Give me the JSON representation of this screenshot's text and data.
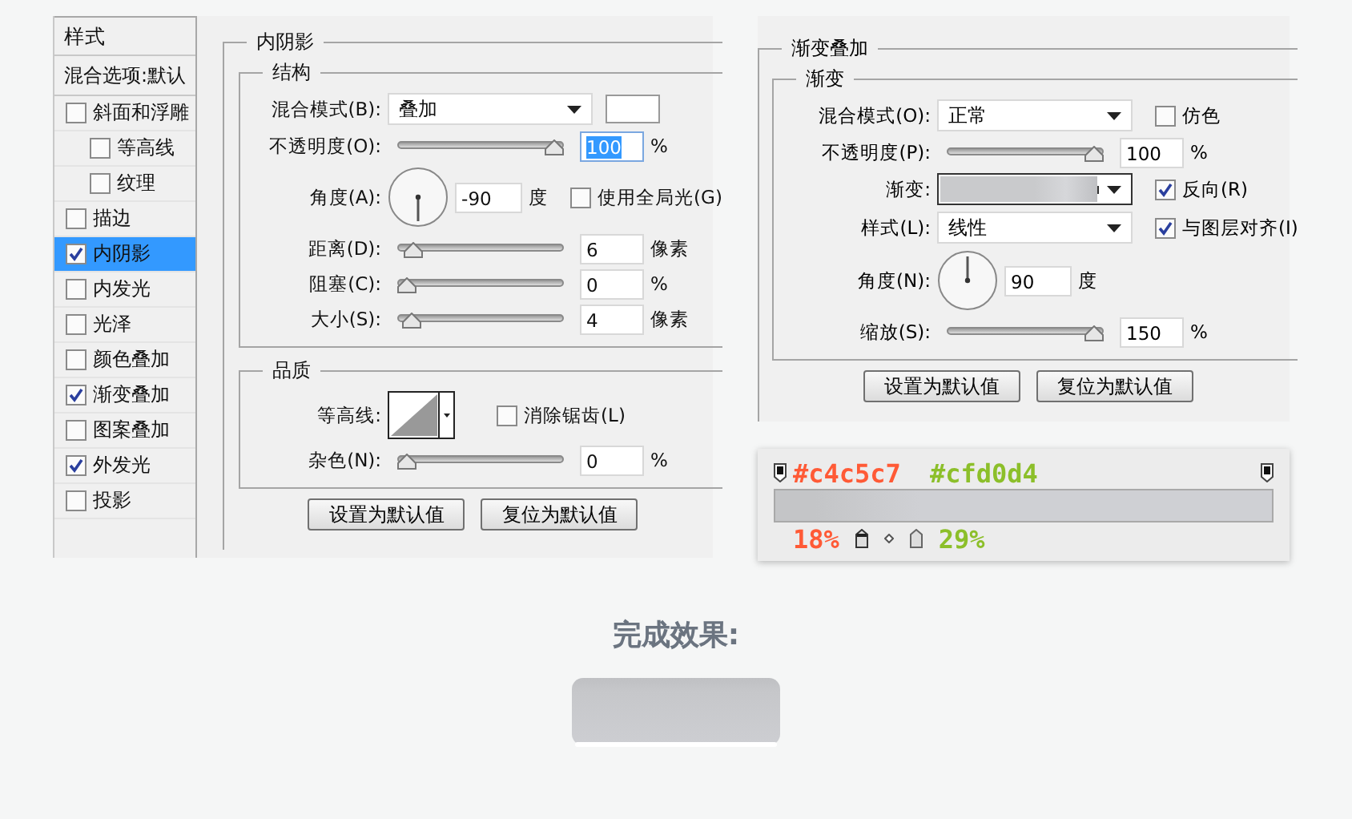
{
  "layer_style": {
    "styles_header": "样式",
    "blend_options": "混合选项:默认",
    "style_items": [
      {
        "label": "斜面和浮雕",
        "checked": false,
        "selected": false,
        "children": [
          {
            "label": "等高线",
            "checked": false,
            "selected": false
          },
          {
            "label": "纹理",
            "checked": false,
            "selected": false
          }
        ]
      },
      {
        "label": "描边",
        "checked": false,
        "selected": false
      },
      {
        "label": "内阴影",
        "checked": true,
        "selected": true
      },
      {
        "label": "内发光",
        "checked": false,
        "selected": false
      },
      {
        "label": "光泽",
        "checked": false,
        "selected": false
      },
      {
        "label": "颜色叠加",
        "checked": false,
        "selected": false
      },
      {
        "label": "渐变叠加",
        "checked": true,
        "selected": false
      },
      {
        "label": "图案叠加",
        "checked": false,
        "selected": false
      },
      {
        "label": "外发光",
        "checked": true,
        "selected": false
      },
      {
        "label": "投影",
        "checked": false,
        "selected": false
      }
    ],
    "panel_title": "内阴影",
    "structure_title": "结构",
    "structure_rows": [
      {
        "kind": "dropdown",
        "label": "混合模式(B):",
        "value": "叠加",
        "swatch": true
      },
      {
        "kind": "slider",
        "label": "不透明度(O):",
        "level": 1,
        "value": "100",
        "unit": "%",
        "focused": true
      },
      {
        "kind": "angle",
        "label": "角度(A):",
        "value": "-90",
        "unit": "度",
        "checkbox": {
          "label": "使用全局光(G)",
          "checked": false
        }
      },
      {
        "kind": "slider",
        "label": "距离(D):",
        "level": 0.04,
        "value": "6",
        "unit": "像素"
      },
      {
        "kind": "slider",
        "label": "阻塞(C):",
        "level": 0,
        "value": "0",
        "unit": "%"
      },
      {
        "kind": "slider",
        "label": "大小(S):",
        "level": 0.03,
        "value": "4",
        "unit": "像素"
      }
    ],
    "quality_title": "品质",
    "quality_rows": [
      {
        "kind": "contour",
        "label": "等高线:",
        "checkbox": {
          "label": "消除锯齿(L)",
          "checked": false
        }
      },
      {
        "kind": "slider",
        "label": "杂色(N):",
        "level": 0,
        "value": "0",
        "unit": "%"
      }
    ],
    "buttons": [
      "设置为默认值",
      "复位为默认值"
    ]
  },
  "gradient_overlay": {
    "panel_title": "渐变叠加",
    "section_title": "渐变",
    "rows": [
      {
        "kind": "dropdown",
        "label": "混合模式(O):",
        "value": "正常",
        "checkbox": {
          "label": "仿色",
          "checked": false
        }
      },
      {
        "kind": "slider",
        "label": "不透明度(P):",
        "level": 1,
        "value": "100",
        "unit": "%"
      },
      {
        "kind": "gradient",
        "label": "渐变:",
        "checkbox": {
          "label": "反向(R)",
          "checked": true
        }
      },
      {
        "kind": "dropdown",
        "label": "样式(L):",
        "value": "线性",
        "checkbox": {
          "label": "与图层对齐(I)",
          "checked": true
        }
      },
      {
        "kind": "angle",
        "label": "角度(N):",
        "value": "90",
        "unit": "度"
      },
      {
        "kind": "slider",
        "label": "缩放(S):",
        "level": 1,
        "value": "150",
        "unit": "%"
      }
    ],
    "buttons": [
      "设置为默认值",
      "复位为默认值"
    ]
  },
  "gradient_editor": {
    "stop_colors": [
      {
        "text": "#c4c5c7",
        "color": "#ff5a36"
      },
      {
        "text": "#cfd0d4",
        "color": "#8cbf2a"
      }
    ],
    "locations": [
      {
        "text": "18%",
        "color": "#ff5a36"
      },
      {
        "text": "29%",
        "color": "#8cbf2a"
      }
    ]
  },
  "result": {
    "title": "完成效果:"
  }
}
